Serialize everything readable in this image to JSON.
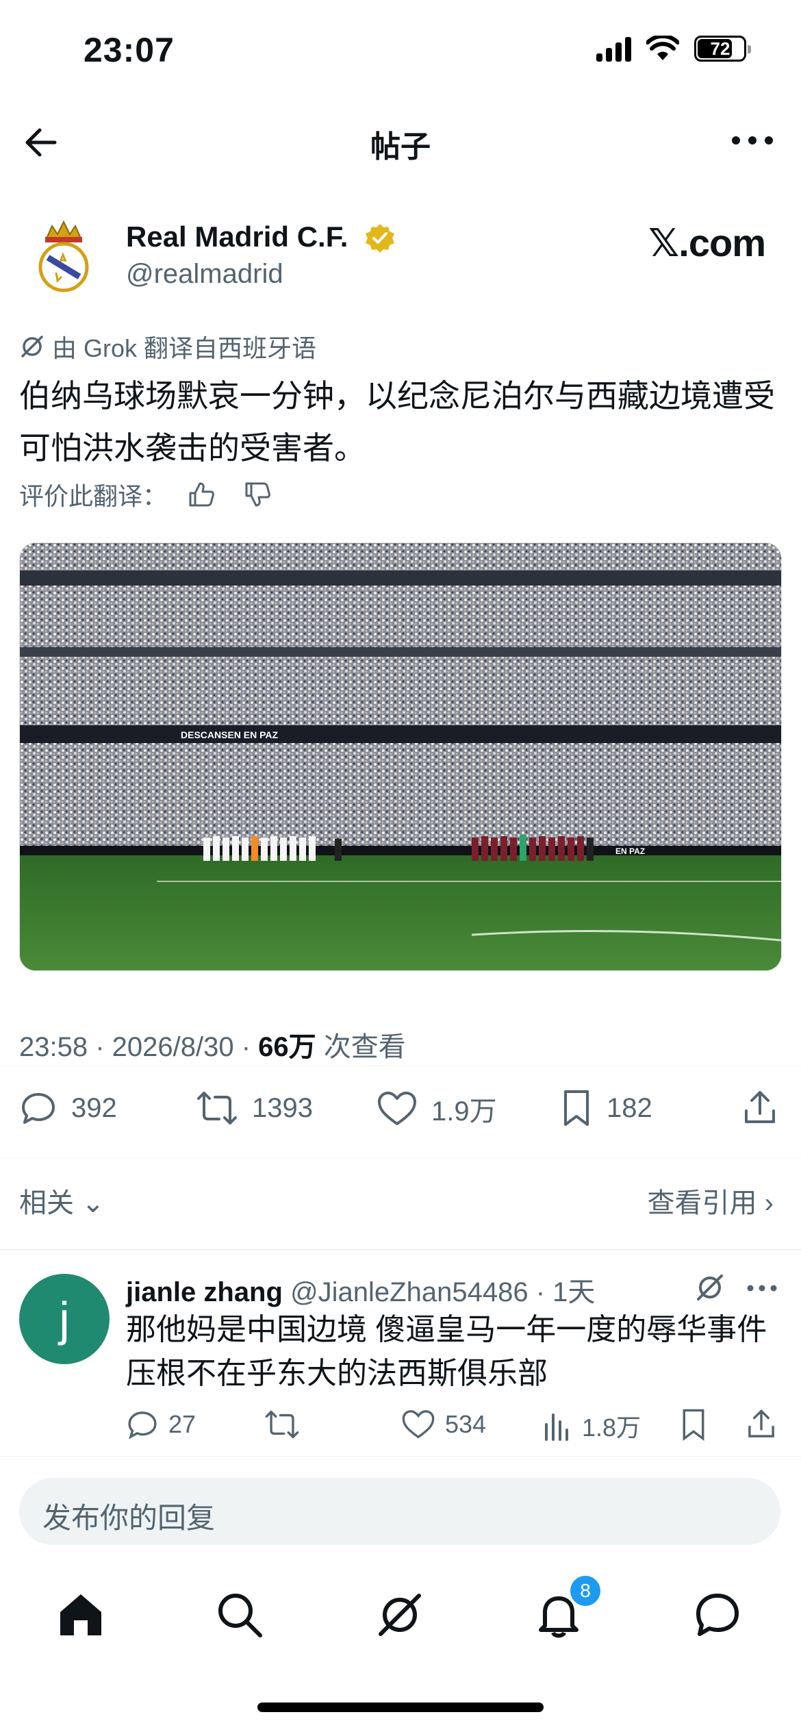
{
  "status_bar": {
    "time": "23:07",
    "battery": "72"
  },
  "header": {
    "title": "帖子"
  },
  "post": {
    "author_name": "Real Madrid C.F.",
    "handle": "@realmadrid",
    "site": "𝕏.com",
    "translation_note": "由 Grok 翻译自西班牙语",
    "text": "伯纳乌球场默哀一分钟，以纪念尼泊尔与西藏边境遭受可怕洪水袭击的受害者。",
    "rate_translation": "评价此翻译：",
    "image_banner": "DESCANSEN EN PAZ",
    "image_board": "EN PAZ",
    "meta_time": "23:58 · 2026/8/30 · ",
    "meta_views": "66万",
    "meta_views_suffix": " 次查看",
    "stats": {
      "replies": "392",
      "reposts": "1393",
      "likes": "1.9万",
      "bookmarks": "182"
    },
    "related_label": "相关",
    "quotes_label": "查看引用"
  },
  "reply": {
    "avatar_letter": "j",
    "name": "jianle zhang",
    "handle": "@JianleZhan54486",
    "time": "· 1天",
    "text": "那他妈是中国边境 傻逼皇马一年一度的辱华事件压根不在乎东大的法西斯俱乐部",
    "stats": {
      "replies": "27",
      "likes": "534",
      "views": "1.8万"
    }
  },
  "compose": {
    "placeholder": "发布你的回复"
  },
  "tabbar": {
    "notifications_badge": "8"
  },
  "colors": {
    "accent": "#1d9bf0",
    "verified": "#e2b719",
    "muted": "#536471",
    "pitch": "#3c7a2e"
  }
}
